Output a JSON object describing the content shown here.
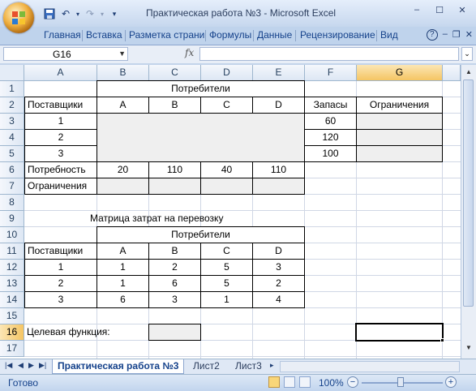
{
  "window": {
    "title": "Практическая работа №3 - Microsoft Excel",
    "controls": [
      "–",
      "☐",
      "✕"
    ]
  },
  "quick_access": {
    "save_icon": "save-icon",
    "undo_icon": "undo-icon",
    "redo_icon": "redo-icon"
  },
  "ribbon": {
    "tabs": [
      "Главная",
      "Вставка",
      "Разметка страни",
      "Формулы",
      "Данные",
      "Рецензирование",
      "Вид"
    ],
    "help": "?",
    "min": "–",
    "restore": "❐",
    "close": "✕"
  },
  "formula_bar": {
    "name_box": "G16",
    "fx": "fx",
    "formula": ""
  },
  "columns": [
    "A",
    "B",
    "C",
    "D",
    "E",
    "F",
    "G"
  ],
  "selected_column": "G",
  "rows": [
    "1",
    "2",
    "3",
    "4",
    "5",
    "6",
    "7",
    "8",
    "9",
    "10",
    "11",
    "12",
    "13",
    "14",
    "15",
    "16",
    "17"
  ],
  "selected_row": "16",
  "cells": {
    "B1": "Потребители",
    "A2": "Поставщики",
    "B2": "A",
    "C2": "B",
    "D2": "C",
    "E2": "D",
    "F2": "Запасы",
    "G2": "Ограничения",
    "A3": "1",
    "F3": "60",
    "A4": "2",
    "F4": "120",
    "A5": "3",
    "F5": "100",
    "A6": "Потребность",
    "B6": "20",
    "C6": "110",
    "D6": "40",
    "E6": "110",
    "A7": "Ограничения",
    "A9": "Матрица затрат на перевозку",
    "B10": "Потребители",
    "A11": "Поставщики",
    "B11": "A",
    "C11": "B",
    "D11": "C",
    "E11": "D",
    "A12": "1",
    "B12": "1",
    "C12": "2",
    "D12": "5",
    "E12": "3",
    "A13": "2",
    "B13": "1",
    "C13": "6",
    "D13": "5",
    "E13": "2",
    "A14": "3",
    "B14": "6",
    "C14": "3",
    "D14": "1",
    "E14": "4",
    "A16": "Целевая функция:"
  },
  "sheet_tabs": [
    "Практическая работа №3",
    "Лист2",
    "Лист3"
  ],
  "active_sheet": "Практическая работа №3",
  "status": {
    "ready": "Готово",
    "zoom": "100%",
    "zoom_out": "−",
    "zoom_in": "+"
  }
}
